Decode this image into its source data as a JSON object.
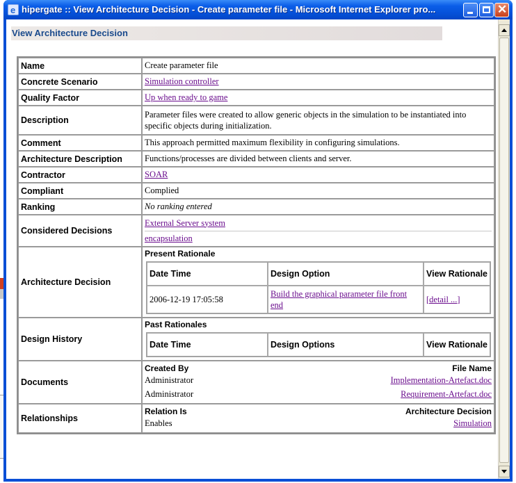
{
  "window": {
    "title": "hipergate :: View Architecture Decision - Create parameter file - Microsoft Internet Explorer pro..."
  },
  "page": {
    "heading": "View Architecture Decision"
  },
  "fields": {
    "name": {
      "label": "Name",
      "value": "Create parameter file"
    },
    "concrete_scenario": {
      "label": "Concrete Scenario",
      "value": "Simulation controller"
    },
    "quality_factor": {
      "label": "Quality Factor",
      "value": "Up when ready to game"
    },
    "description": {
      "label": "Description",
      "value": "Parameter files were created to allow generic objects in the simulation to be instantiated into specific objects during initialization."
    },
    "comment": {
      "label": "Comment",
      "value": "This approach permitted maximum flexibility in configuring simulations."
    },
    "architecture_description": {
      "label": "Architecture Description",
      "value": "Functions/processes are divided between clients and server."
    },
    "contractor": {
      "label": "Contractor",
      "value": "SOAR"
    },
    "compliant": {
      "label": "Compliant",
      "value": "Complied"
    },
    "ranking": {
      "label": "Ranking",
      "value": "No ranking entered"
    },
    "considered_decisions": {
      "label": "Considered Decisions",
      "items": [
        "External Server system",
        "encapsulation"
      ]
    }
  },
  "architecture_decision": {
    "label": "Architecture Decision",
    "section_title": "Present Rationale",
    "headers": {
      "datetime": "Date   Time",
      "option": "Design Option",
      "view": "View Rationale"
    },
    "rows": [
      {
        "datetime": "2006-12-19 17:05:58",
        "option": "Build the graphical parameter file front end",
        "view": "[detail ...]"
      }
    ]
  },
  "design_history": {
    "label": "Design History",
    "section_title": "Past Rationales",
    "headers": {
      "datetime": "Date   Time",
      "option": "Design Options",
      "view": "View Rationale"
    }
  },
  "documents": {
    "label": "Documents",
    "headers": {
      "created_by": "Created By",
      "file_name": "File Name"
    },
    "rows": [
      {
        "created_by": "Administrator",
        "file_name": "Implementation-Artefact.doc"
      },
      {
        "created_by": "Administrator",
        "file_name": "Requirement-Artefact.doc"
      }
    ]
  },
  "relationships": {
    "label": "Relationships",
    "headers": {
      "relation": "Relation Is",
      "decision": "Architecture Decision"
    },
    "rows": [
      {
        "relation": "Enables",
        "decision": "Simulation"
      }
    ]
  }
}
